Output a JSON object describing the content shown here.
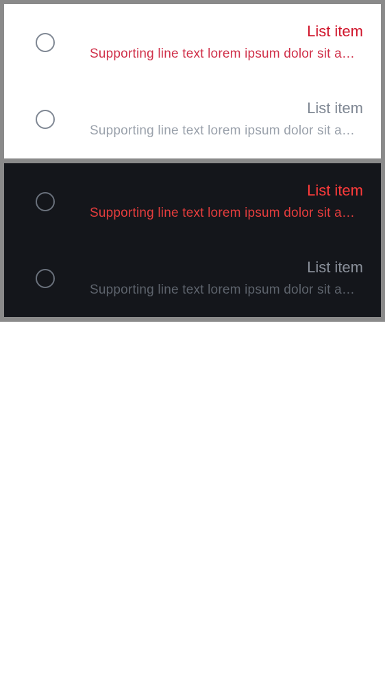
{
  "light_panel": {
    "items": [
      {
        "headline": "List item",
        "supporting": "Supporting line text lorem ipsum dolor sit amet, consectetur.",
        "icon": "radio-unchecked-icon",
        "state": "error"
      },
      {
        "headline": "List item",
        "supporting": "Supporting line text lorem ipsum dolor sit amet, consectetur.",
        "icon": "radio-unchecked-icon",
        "state": "disabled"
      }
    ]
  },
  "dark_panel": {
    "items": [
      {
        "headline": "List item",
        "supporting": "Supporting line text lorem ipsum dolor sit amet, consectetur.",
        "icon": "radio-unchecked-icon",
        "state": "error"
      },
      {
        "headline": "List item",
        "supporting": "Supporting line text lorem ipsum dolor sit amet, consectetur.",
        "icon": "radio-unchecked-icon",
        "state": "disabled"
      }
    ]
  },
  "colors": {
    "frame": "#8a8a8a",
    "light_bg": "#ffffff",
    "dark_bg": "#14161b",
    "error_light": "#d0142a",
    "error_dark": "#ff3b3b",
    "disabled": "#7f8793"
  }
}
